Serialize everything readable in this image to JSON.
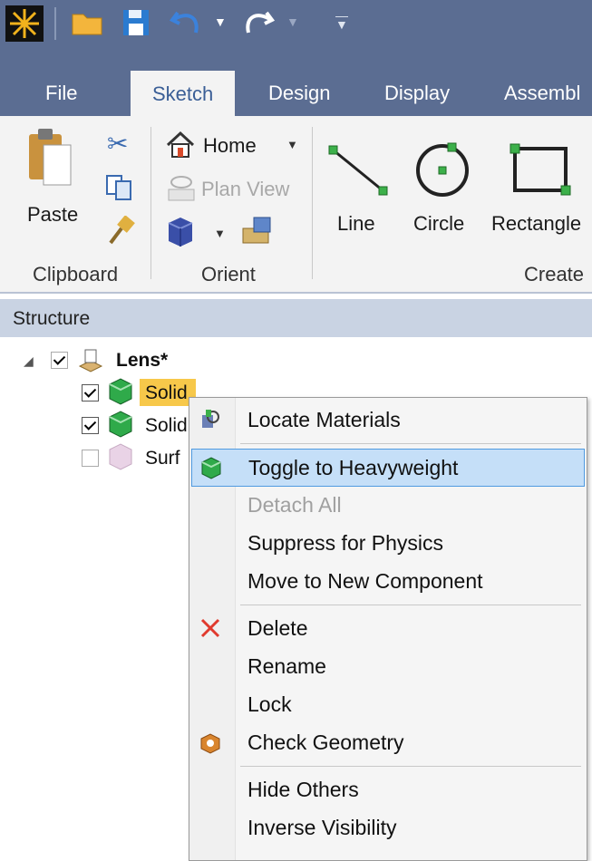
{
  "tabs": [
    "File",
    "Sketch",
    "Design",
    "Display",
    "Assembl"
  ],
  "active_tab": "Sketch",
  "ribbon": {
    "clipboard": {
      "paste": "Paste",
      "group": "Clipboard"
    },
    "orient": {
      "home": "Home",
      "plan_view": "Plan View",
      "group": "Orient"
    },
    "create": {
      "line": "Line",
      "circle": "Circle",
      "rectangle": "Rectangle",
      "group": "Create"
    }
  },
  "structure": {
    "header": "Structure",
    "root": "Lens*",
    "items": [
      "Solid",
      "Solid",
      "Surf"
    ]
  },
  "context_menu": {
    "locate_materials": "Locate Materials",
    "toggle_heavyweight": "Toggle to Heavyweight",
    "detach_all": "Detach All",
    "suppress_physics": "Suppress for Physics",
    "move_component": "Move to New Component",
    "delete": "Delete",
    "rename": "Rename",
    "lock": "Lock",
    "check_geometry": "Check Geometry",
    "hide_others": "Hide Others",
    "inverse_visibility": "Inverse Visibility"
  },
  "colors": {
    "titlebar": "#5b6d92",
    "ribbon": "#f3f3f3",
    "highlight": "#c5dff8",
    "selection": "#f7c84a"
  }
}
